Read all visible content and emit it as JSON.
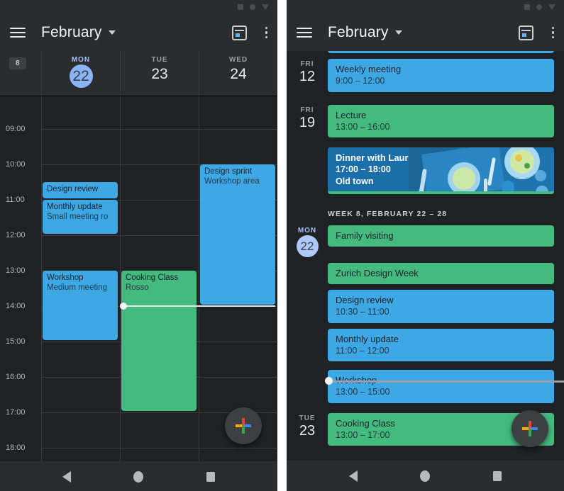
{
  "app": {
    "title": "February",
    "icons": {
      "menu": "hamburger-menu-icon",
      "caret": "chevron-down-icon",
      "today": "today-calendar-icon",
      "overflow": "more-vert-icon",
      "fab": "add-plus-icon"
    }
  },
  "colors": {
    "background": "#202124",
    "appbar": "#2b2c2e",
    "blue_event": "#3ea8e5",
    "green_event": "#44ba7f",
    "today_accent": "#8ab4f8",
    "photo_event": "#1a6fa8"
  },
  "day_view": {
    "week_badge": "8",
    "days": [
      {
        "dow": "MON",
        "num": "22",
        "today": true
      },
      {
        "dow": "TUE",
        "num": "23",
        "today": false
      },
      {
        "dow": "WED",
        "num": "24",
        "today": false
      }
    ],
    "hours": [
      "09:00",
      "10:00",
      "11:00",
      "12:00",
      "13:00",
      "14:00",
      "15:00",
      "16:00",
      "17:00",
      "18:00"
    ],
    "current_time_label": "14:00",
    "events": [
      {
        "title": "Design review",
        "location": "",
        "day": 0,
        "start": 10.5,
        "end": 11.0,
        "color": "blue"
      },
      {
        "title": "Monthly update",
        "location": "Small meeting ro",
        "day": 0,
        "start": 11.0,
        "end": 12.0,
        "color": "blue"
      },
      {
        "title": "Workshop",
        "location": "Medium meeting",
        "day": 0,
        "start": 13.0,
        "end": 15.0,
        "color": "blue"
      },
      {
        "title": "Cooking Class",
        "location": "Rosso",
        "day": 1,
        "start": 13.0,
        "end": 17.0,
        "color": "green"
      },
      {
        "title": "Design sprint",
        "location": "Workshop area",
        "day": 2,
        "start": 10.0,
        "end": 14.0,
        "color": "blue"
      }
    ]
  },
  "schedule_view": {
    "week_header": "WEEK 8, FEBRUARY 22 – 28",
    "rows": [
      {
        "kind": "event",
        "dow": "FRI",
        "num": "12",
        "today": false,
        "show_date": true,
        "title": "Weekly meeting",
        "time": "9:00 – 12:00",
        "location": "",
        "color": "blue"
      },
      {
        "kind": "event",
        "dow": "FRI",
        "num": "19",
        "today": false,
        "show_date": true,
        "title": "Lecture",
        "time": "13:00 – 16:00",
        "location": "",
        "color": "green"
      },
      {
        "kind": "photo",
        "dow": "",
        "num": "",
        "today": false,
        "show_date": false,
        "title": "Dinner with Laura",
        "time": "17:00 – 18:00",
        "location": "Old town",
        "color": "photo"
      },
      {
        "kind": "event",
        "dow": "MON",
        "num": "22",
        "today": true,
        "show_date": true,
        "title": "Family visiting",
        "time": "",
        "location": "",
        "color": "green"
      },
      {
        "kind": "event",
        "dow": "",
        "num": "",
        "today": false,
        "show_date": false,
        "title": "Zurich Design Week",
        "time": "",
        "location": "",
        "color": "green"
      },
      {
        "kind": "event",
        "dow": "",
        "num": "",
        "today": false,
        "show_date": false,
        "title": "Design review",
        "time": "10:30 – 11:00",
        "location": "",
        "color": "blue"
      },
      {
        "kind": "event",
        "dow": "",
        "num": "",
        "today": false,
        "show_date": false,
        "title": "Monthly update",
        "time": "11:00 – 12:00",
        "location": "",
        "color": "blue"
      },
      {
        "kind": "event",
        "dow": "",
        "num": "",
        "today": false,
        "show_date": false,
        "title": "Workshop",
        "time": "13:00 – 15:00",
        "location": "",
        "color": "blue"
      },
      {
        "kind": "event",
        "dow": "TUE",
        "num": "23",
        "today": false,
        "show_date": true,
        "title": "Cooking Class",
        "time": "13:00 – 17:00",
        "location": "",
        "color": "green"
      }
    ]
  },
  "navbar": {
    "back": "back-triangle-icon",
    "home": "home-circle-icon",
    "recents": "recents-square-icon"
  }
}
